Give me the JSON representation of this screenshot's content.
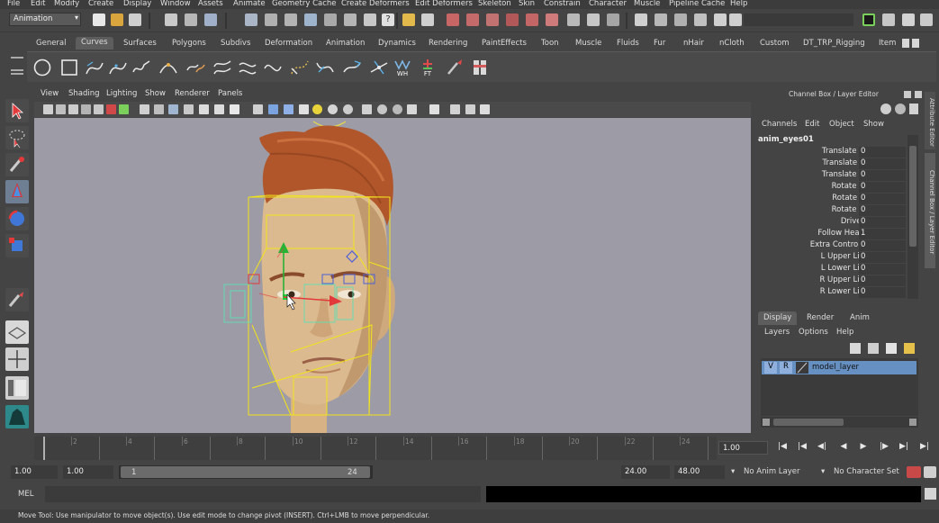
{
  "menubar": {
    "items": [
      "File",
      "Edit",
      "Modify",
      "Create",
      "Display",
      "Window",
      "Assets",
      "Animate",
      "Geometry Cache",
      "Create Deformers",
      "Edit Deformers",
      "Skeleton",
      "Skin",
      "Constrain",
      "Character",
      "Muscle",
      "Pipeline Cache",
      "Help"
    ]
  },
  "statusline": {
    "mode": "Animation"
  },
  "shelf": {
    "tabs": [
      "General",
      "Curves",
      "Surfaces",
      "Polygons",
      "Subdivs",
      "Deformation",
      "Animation",
      "Dynamics",
      "Rendering",
      "PaintEffects",
      "Toon",
      "Muscle",
      "Fluids",
      "Fur",
      "nHair",
      "nCloth",
      "Custom",
      "DT_TRP_Rigging",
      "Item"
    ],
    "active_tab": "Curves",
    "icon_labels": {
      "wh": "WH",
      "ft": "FT"
    }
  },
  "panel": {
    "menu": [
      "View",
      "Shading",
      "Lighting",
      "Show",
      "Renderer",
      "Panels"
    ]
  },
  "channel_box": {
    "title": "Channel Box / Layer Editor",
    "menu": [
      "Channels",
      "Edit",
      "Object",
      "Show"
    ],
    "object": "anim_eyes01",
    "attributes": [
      {
        "label": "Translate X",
        "value": "0"
      },
      {
        "label": "Translate Y",
        "value": "0"
      },
      {
        "label": "Translate Z",
        "value": "0"
      },
      {
        "label": "Rotate X",
        "value": "0"
      },
      {
        "label": "Rotate Y",
        "value": "0"
      },
      {
        "label": "Rotate Z",
        "value": "0"
      },
      {
        "label": "Driver",
        "value": "0"
      },
      {
        "label": "Follow Head",
        "value": "1"
      },
      {
        "label": "Extra Controls",
        "value": "0"
      },
      {
        "label": "L Upper Lid",
        "value": "0"
      },
      {
        "label": "L Lower Lid",
        "value": "0"
      },
      {
        "label": "R Upper Lid",
        "value": "0"
      },
      {
        "label": "R Lower Lid",
        "value": "0"
      }
    ]
  },
  "layer_editor": {
    "tabs": [
      "Display",
      "Render",
      "Anim"
    ],
    "active_tab": "Display",
    "menu": [
      "Layers",
      "Options",
      "Help"
    ],
    "layer": {
      "v": "V",
      "r": "R",
      "name": "model_layer"
    }
  },
  "side_tabs": {
    "attribute_editor": "Attribute Editor",
    "channel_box": "Channel Box / Layer Editor"
  },
  "timeline": {
    "ticks": [
      "2",
      "4",
      "6",
      "8",
      "10",
      "12",
      "14",
      "16",
      "18",
      "20",
      "22",
      "24"
    ],
    "current_frame": "1.00",
    "playback_icons": [
      "go-start-icon",
      "step-back-key-icon",
      "step-back-icon",
      "play-back-icon",
      "play-forward-icon",
      "step-forward-icon",
      "step-forward-key-icon",
      "go-end-icon"
    ]
  },
  "range": {
    "start_time": "1.00",
    "playback_start": "1.00",
    "range_start_label": "1",
    "range_end_label": "24",
    "playback_end": "24.00",
    "end_time": "48.00",
    "anim_layer": "No Anim Layer",
    "character_set": "No Character Set"
  },
  "command_line": {
    "label": "MEL"
  },
  "help_line": {
    "text": "Move Tool: Use manipulator to move object(s). Use edit mode to change pivot (INSERT).  Ctrl+LMB to move perpendicular."
  },
  "colors": {
    "viewport_bg": "#9d9ba5",
    "selection_yellow": "#f2e41c",
    "layer_highlight": "#6790c2",
    "hair": "#b0562a",
    "skin": "#d9b98d"
  }
}
